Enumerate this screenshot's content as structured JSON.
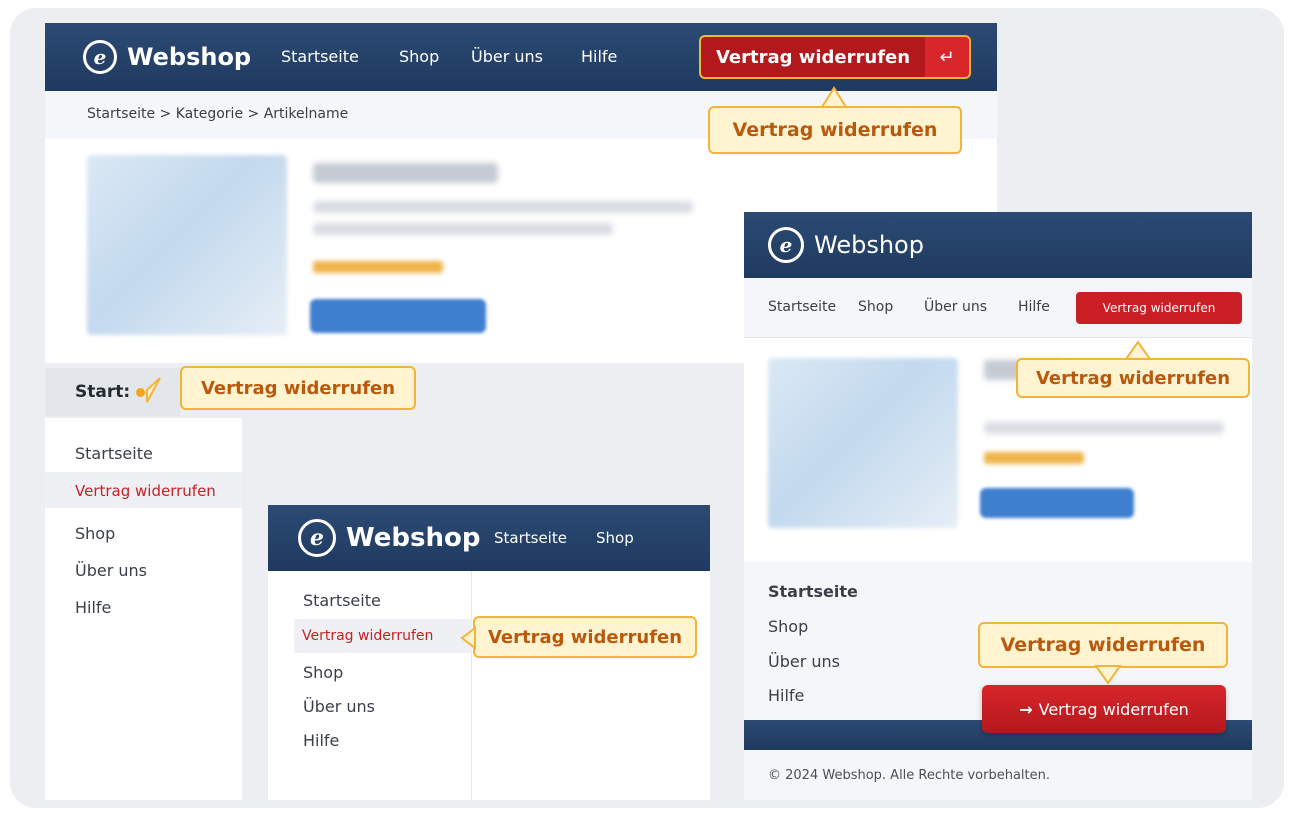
{
  "brand": "Webshop",
  "logo_letter": "e",
  "nav": [
    "Startseite",
    "Shop",
    "Über uns",
    "Hilfe"
  ],
  "revoke_label": "Vertrag widerrufen",
  "enter_icon": "↵",
  "arrow_icon": "→",
  "breadcrumb": "Startseite > Kategorie > Artikelname",
  "start_label": "Start:",
  "sidebar_items": [
    "Startseite",
    "Vertrag widerrufen",
    "Shop",
    "Über uns",
    "Hilfe"
  ],
  "callout_label": "Vertrag widerrufen",
  "footer_nav": [
    "Startseite",
    "Shop",
    "Über uns",
    "Hilfe"
  ],
  "footer_text": "© 2024  Webshop. Alle Rechte vorbehalten.",
  "colors": {
    "navy": "#24416a",
    "accent_red": "#c81e24",
    "callout_bg": "#fff4cf",
    "callout_border": "#f2b43b",
    "callout_text": "#b8590e"
  }
}
